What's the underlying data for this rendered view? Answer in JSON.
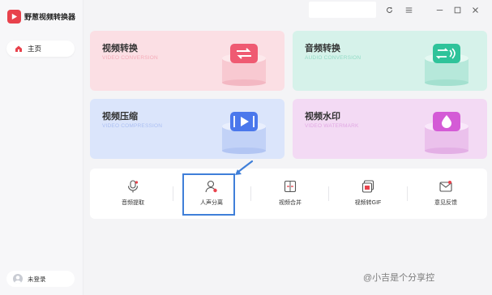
{
  "app": {
    "name": "野葱视频转换器"
  },
  "sidebar": {
    "home_label": "主页",
    "user_label": "未登录"
  },
  "cards": [
    {
      "title": "视频转换",
      "subtitle": "VIDEO CONVERSION",
      "color": "#ef5a72",
      "icon": "video-convert-icon"
    },
    {
      "title": "音频转换",
      "subtitle": "AUDIO CONVERSION",
      "color": "#2fc39a",
      "icon": "audio-convert-icon"
    },
    {
      "title": "视频压缩",
      "subtitle": "VIDEO COMPRESSION",
      "color": "#4b78ec",
      "icon": "video-compress-icon"
    },
    {
      "title": "视频水印",
      "subtitle": "VIDEO WATERMARK",
      "color": "#d45bd6",
      "icon": "video-watermark-icon"
    }
  ],
  "tools": [
    {
      "label": "音频提取",
      "icon": "audio-extract-icon"
    },
    {
      "label": "人声分离",
      "icon": "voice-separation-icon"
    },
    {
      "label": "视频合并",
      "icon": "video-merge-icon"
    },
    {
      "label": "视频转GIF",
      "icon": "video-to-gif-icon"
    },
    {
      "label": "意见反馈",
      "icon": "feedback-icon"
    }
  ],
  "highlight_color": "#3f7fd9",
  "watermark": "@小吉是个分享控"
}
